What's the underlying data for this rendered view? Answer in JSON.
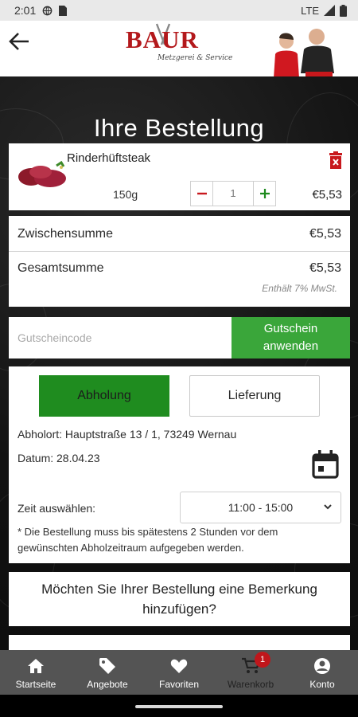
{
  "status_bar": {
    "time": "2:01",
    "network": "LTE"
  },
  "header": {
    "logo_text": "BAUR",
    "logo_tagline": "Metzgerei & Service"
  },
  "page": {
    "title": "Ihre Bestellung"
  },
  "product": {
    "name": "Rinderhüftsteak",
    "weight": "150g",
    "quantity": "1",
    "price": "€5,53"
  },
  "totals": {
    "subtotal_label": "Zwischensumme",
    "subtotal_value": "€5,53",
    "total_label": "Gesamtsumme",
    "total_value": "€5,53",
    "vat_note": "Enthält 7% MwSt."
  },
  "voucher": {
    "placeholder": "Gutscheincode",
    "button_label": "Gutschein anwenden"
  },
  "pickup": {
    "tab_pickup": "Abholung",
    "tab_delivery": "Lieferung",
    "location": "Abholort: Hauptstraße 13 / 1, 73249 Wernau",
    "date": "Datum: 28.04.23",
    "time_label": "Zeit auswählen:",
    "time_selected": "11:00 - 15:00",
    "note": "* Die Bestellung muss bis spätestens 2 Stunden vor dem gewünschten Abholzeitraum aufgegeben werden."
  },
  "remark": {
    "prompt": "Möchten Sie Ihrer Bestellung eine Bemerkung hinzufügen?"
  },
  "nav": {
    "items": [
      {
        "label": "Startseite",
        "icon": "home-icon"
      },
      {
        "label": "Angebote",
        "icon": "tag-icon"
      },
      {
        "label": "Favoriten",
        "icon": "heart-icon"
      },
      {
        "label": "Warenkorb",
        "icon": "cart-icon"
      },
      {
        "label": "Konto",
        "icon": "account-icon"
      }
    ],
    "cart_badge": "1"
  },
  "colors": {
    "brand_red": "#b3181b",
    "green": "#3aa63a",
    "green_dark": "#1f8c1f"
  }
}
